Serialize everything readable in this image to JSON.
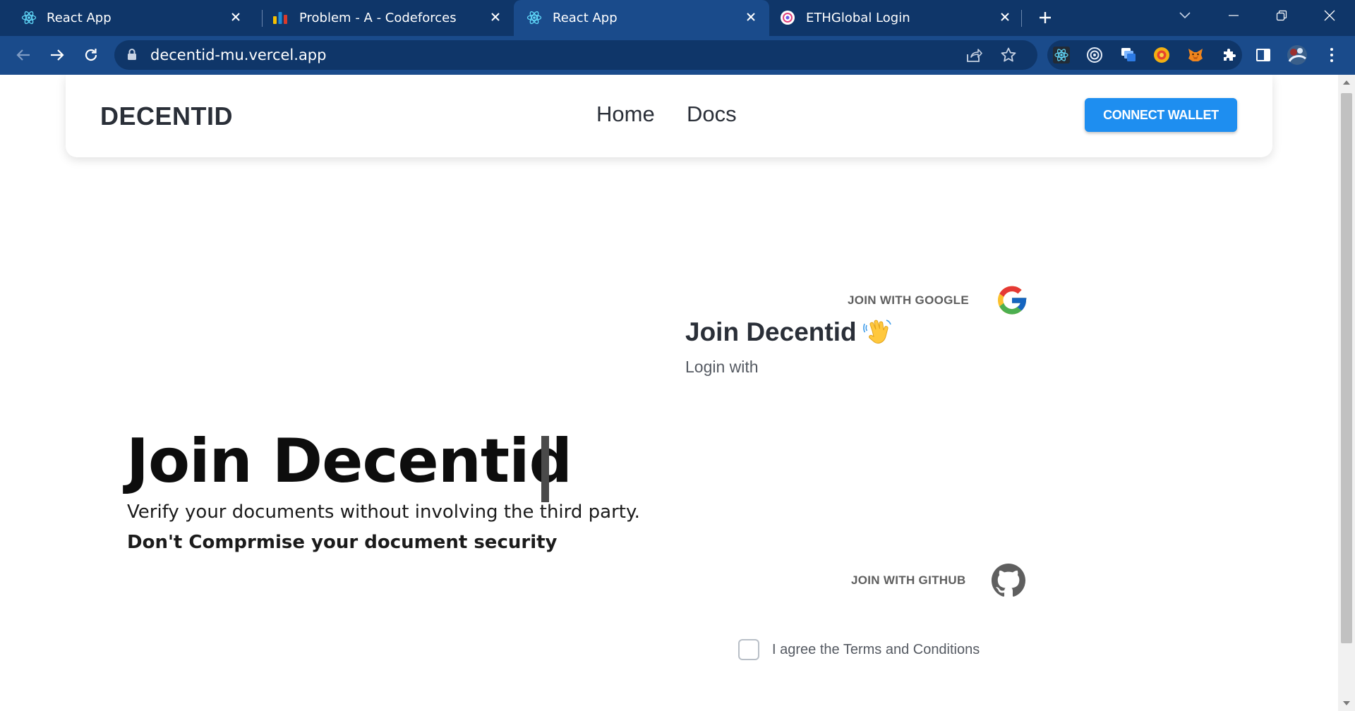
{
  "browser": {
    "tabs": [
      {
        "title": "React App",
        "icon": "react-icon",
        "active": false
      },
      {
        "title": "Problem - A - Codeforces",
        "icon": "codeforces-icon",
        "active": false
      },
      {
        "title": "React App",
        "icon": "react-icon",
        "active": true
      },
      {
        "title": "ETHGlobal Login",
        "icon": "ethglobal-icon",
        "active": false
      }
    ],
    "url": "decentid-mu.vercel.app",
    "colors": {
      "frame": "#0f3669",
      "toolbar": "#1a4b8b"
    }
  },
  "site": {
    "brand": "DECENTID",
    "nav": {
      "home": "Home",
      "docs": "Docs"
    },
    "connect_label": "CONNECT WALLET",
    "hero": {
      "title": "Join Decentid",
      "subtitle": "Verify your documents without involving the third party.",
      "tagline": "Don't Comprmise your document security"
    },
    "login": {
      "title": "Join Decentid",
      "emoji": "waving-hand-icon",
      "login_with": "Login with",
      "google_label": "JOIN WITH GOOGLE",
      "github_label": "JOIN WITH GITHUB",
      "terms_label": "I agree the Terms and Conditions"
    },
    "colors": {
      "accent": "#1e8ef0",
      "text": "#2a2f38"
    }
  }
}
